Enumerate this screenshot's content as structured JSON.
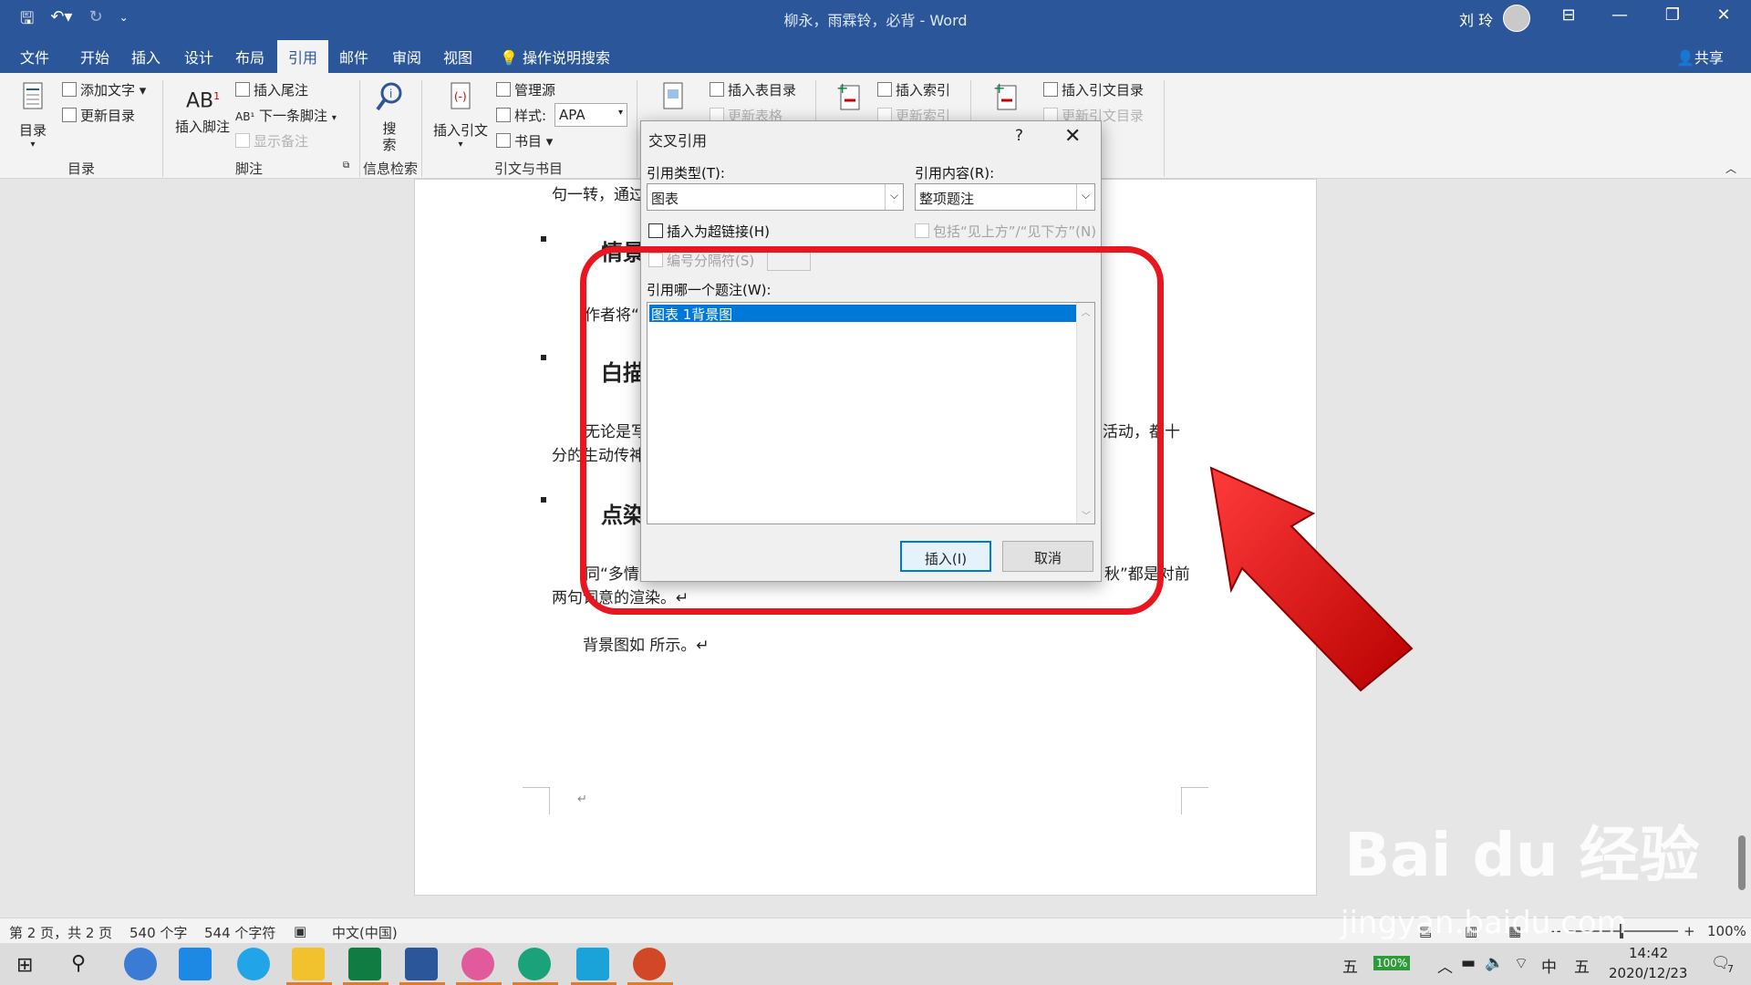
{
  "titlebar": {
    "title": "柳永，雨霖铃，必背 - Word",
    "user": "刘 玲"
  },
  "tabs": [
    "文件",
    "开始",
    "插入",
    "设计",
    "布局",
    "引用",
    "邮件",
    "审阅",
    "视图"
  ],
  "tab_search": "操作说明搜索",
  "share": "共享",
  "ribbon": {
    "toc_big": "目录",
    "add_text": "添加文字 ▾",
    "update_toc": "更新目录",
    "group_toc": "目录",
    "insert_footnote": "插入脚注",
    "insert_endnote": "插入尾注",
    "next_footnote": "下一条脚注",
    "show_notes": "显示备注",
    "group_footnote": "脚注",
    "search_big": "搜索",
    "group_research": "信息检索",
    "insert_citation": "插入引文",
    "manage_sources": "管理源",
    "style_label": "样式:",
    "style_value": "APA",
    "bibliography": "书目 ▾",
    "group_citations": "引文与书目",
    "insert_tof": "插入表目录",
    "update_table": "更新表格",
    "insert_index": "插入索引",
    "update_index": "更新索引",
    "insert_toa": "插入引文目录",
    "update_toa": "更新引文目录"
  },
  "document": {
    "line1": "句一转，通过",
    "head1": "情景",
    "line2": "作者将“",
    "head2": "白描",
    "line3a": "无论是写",
    "line3b": "活动，都十",
    "line3c": "分的生动传神",
    "head3": "点染",
    "line4a": "同“多情",
    "line4b": "秋”都是对前",
    "line4c": "两句词意的渲染。↵",
    "line5": "背景图如  所示。↵",
    "para_mark": "↵"
  },
  "dialog": {
    "title": "交叉引用",
    "help": "?",
    "close": "✕",
    "ref_type_label": "引用类型(T):",
    "ref_type_value": "图表",
    "ref_content_label": "引用内容(R):",
    "ref_content_value": "整项题注",
    "hyperlink_label": "插入为超链接(H)",
    "above_below_label": "包括“见上方”/“见下方”(N)",
    "separator_label": "编号分隔符(S)",
    "which_caption_label": "引用哪一个题注(W):",
    "captions": [
      "图表 1背景图"
    ],
    "insert_btn": "插入(I)",
    "cancel_btn": "取消"
  },
  "statusbar": {
    "page": "第 2 页，共 2 页",
    "words": "540 个字",
    "chars": "544 个字符",
    "lang": "中文(中国)",
    "zoom": "100%"
  },
  "taskbar": {
    "ime": "五",
    "battery": "100%",
    "lang": "中",
    "ime2": "五",
    "time": "14:42",
    "date": "2020/12/23",
    "notif": "7"
  },
  "watermark": {
    "brand": "Bai du 经验",
    "url": "jingyan.baidu.com"
  },
  "colors": {
    "word_blue": "#2b579a",
    "highlight": "#e8171f",
    "select": "#0078d7"
  }
}
